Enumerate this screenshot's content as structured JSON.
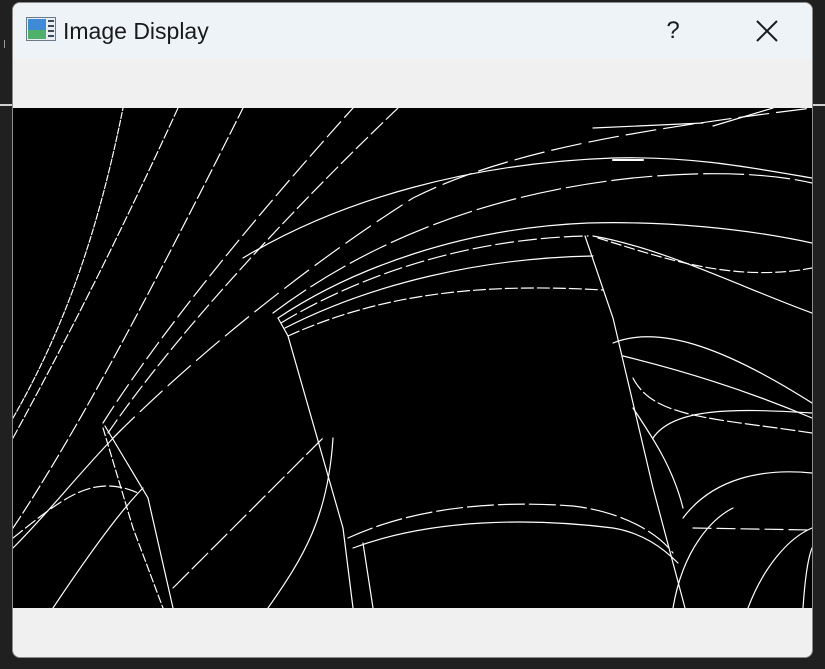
{
  "window": {
    "title": "Image Display",
    "help_label": "?",
    "icon": "image-window-icon",
    "close_icon": "close-icon"
  },
  "display": {
    "content": "edge-detection-image",
    "background_color": "#000000",
    "edge_color": "#ffffff"
  }
}
